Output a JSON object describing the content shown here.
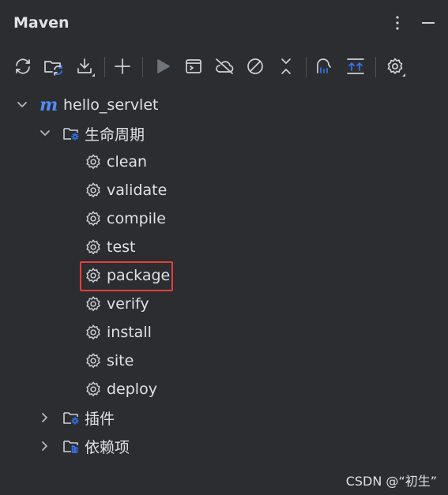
{
  "panel": {
    "title": "Maven",
    "options_icon": "more-vertical-icon",
    "minimize_icon": "minimize-icon"
  },
  "toolbar": {
    "buttons": [
      {
        "name": "reload-all-projects",
        "icon": "sync-icon"
      },
      {
        "name": "reload-folder",
        "icon": "folder-refresh-icon"
      },
      {
        "name": "download-sources",
        "icon": "download-icon"
      },
      {
        "name": "add-project",
        "icon": "plus-icon"
      },
      {
        "name": "run",
        "icon": "play-icon"
      },
      {
        "name": "execute-goal",
        "icon": "terminal-window-icon"
      },
      {
        "name": "toggle-offline",
        "icon": "cloud-off-icon"
      },
      {
        "name": "skip-tests",
        "icon": "no-sign-icon"
      },
      {
        "name": "collapse-all",
        "icon": "collapse-icon"
      },
      {
        "name": "show-dependencies",
        "icon": "diagram-icon"
      },
      {
        "name": "expand-all",
        "icon": "expand-icon"
      },
      {
        "name": "settings",
        "icon": "gear-icon"
      }
    ]
  },
  "tree": {
    "project": "hello_servlet",
    "lifecycle": {
      "label": "生命周期",
      "goals": [
        "clean",
        "validate",
        "compile",
        "test",
        "package",
        "verify",
        "install",
        "site",
        "deploy"
      ]
    },
    "plugins_label": "插件",
    "dependencies_label": "依赖项",
    "highlighted_goal": "package"
  },
  "watermark": "CSDN @“初生”",
  "colors": {
    "background": "#2b2d30",
    "text": "#dfe1e5",
    "maven_logo": "#548af7",
    "highlight_border": "#e0403d",
    "folder_badge": "#3574f0"
  }
}
